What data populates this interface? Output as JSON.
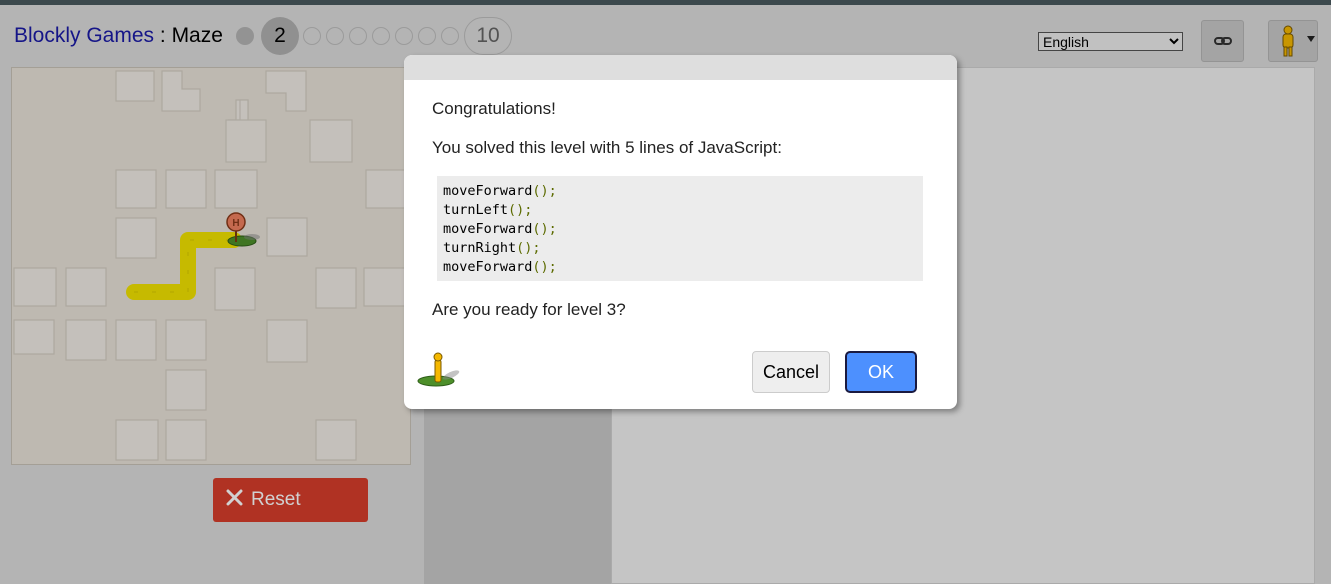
{
  "header": {
    "app_name": "Blockly Games",
    "separator": " : ",
    "game_name": "Maze",
    "levels": {
      "current": "2",
      "last": "10"
    },
    "language": {
      "selected": "English"
    },
    "link_icon": "link-icon",
    "pegman_icon": "pegman-icon"
  },
  "controls": {
    "reset_label": "Reset",
    "reset_icon": "close-icon",
    "reset_color": "#d73e2b"
  },
  "dialog": {
    "congrats": "Congratulations!",
    "solved": "You solved this level with 5 lines of JavaScript:",
    "code": [
      {
        "fn": "moveForward",
        "args": "();"
      },
      {
        "fn": "turnLeft",
        "args": "();"
      },
      {
        "fn": "moveForward",
        "args": "();"
      },
      {
        "fn": "turnRight",
        "args": "();"
      },
      {
        "fn": "moveForward",
        "args": "();"
      }
    ],
    "question": "Are you ready for level 3?",
    "cancel_label": "Cancel",
    "ok_label": "OK",
    "ok_color": "#4d90fe",
    "pegman_icon": "pegman-icon"
  }
}
